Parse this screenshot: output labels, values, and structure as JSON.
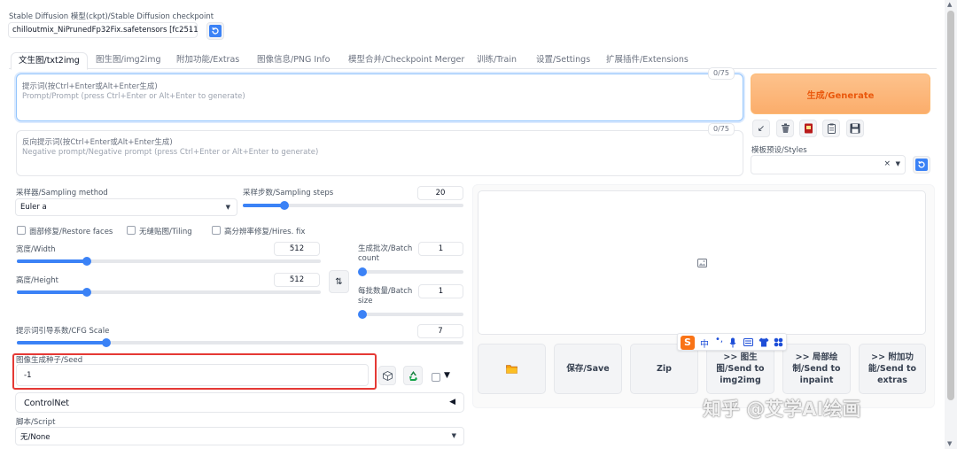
{
  "checkpoint": {
    "label": "Stable Diffusion 模型(ckpt)/Stable Diffusion checkpoint",
    "value": "chilloutmix_NiPrunedFp32Fix.safetensors [fc2511"
  },
  "tabs": [
    {
      "label": "文生图/txt2img"
    },
    {
      "label": "图生图/img2img"
    },
    {
      "label": "附加功能/Extras"
    },
    {
      "label": "图像信息/PNG Info"
    },
    {
      "label": "模型合并/Checkpoint Merger"
    },
    {
      "label": "训练/Train"
    },
    {
      "label": "设置/Settings"
    },
    {
      "label": "扩展插件/Extensions"
    }
  ],
  "prompt": {
    "counter": "0/75",
    "placeholder_line1": "提示词(按Ctrl+Enter或Alt+Enter生成)",
    "placeholder_line2": "Prompt/Prompt (press Ctrl+Enter or Alt+Enter to generate)"
  },
  "negative_prompt": {
    "counter": "0/75",
    "placeholder_line1": "反向提示词(按Ctrl+Enter或Alt+Enter生成)",
    "placeholder_line2": "Negative prompt/Negative prompt (press Ctrl+Enter or Alt+Enter to generate)"
  },
  "generate_label": "生成/Generate",
  "styles_label": "模板预设/Styles",
  "sampler": {
    "label": "采样器/Sampling method",
    "value": "Euler a"
  },
  "steps": {
    "label": "采样步数/Sampling steps",
    "value": "20",
    "fraction": 0.19
  },
  "checkboxes": {
    "restore_faces": "面部修复/Restore faces",
    "tiling": "无缝贴图/Tiling",
    "hires_fix": "高分辨率修复/Hires. fix"
  },
  "width": {
    "label": "宽度/Width",
    "value": "512",
    "fraction": 0.23
  },
  "height": {
    "label": "高度/Height",
    "value": "512",
    "fraction": 0.23
  },
  "batch_count": {
    "label_line1": "生成批次/Batch",
    "label_line2": "count",
    "value": "1",
    "fraction": 0.0
  },
  "batch_size": {
    "label_line1": "每批数量/Batch",
    "label_line2": "size",
    "value": "1",
    "fraction": 0.0
  },
  "cfg": {
    "label": "提示词引导系数/CFG Scale",
    "value": "7",
    "fraction": 0.2
  },
  "seed": {
    "label": "图像生成种子/Seed",
    "value": "-1"
  },
  "controlnet_label": "ControlNet",
  "script": {
    "label": "脚本/Script",
    "value": "无/None"
  },
  "output_buttons": {
    "save": "保存/Save",
    "zip": "Zip",
    "send_img2img_1": ">> 图生",
    "send_img2img_2": "图/Send to",
    "send_img2img_3": "img2img",
    "send_inpaint_1": ">> 局部绘",
    "send_inpaint_2": "制/Send to",
    "send_inpaint_3": "inpaint",
    "send_extras_1": ">> 附加功",
    "send_extras_2": "能/Send to",
    "send_extras_3": "extras"
  },
  "ime_char": "中",
  "watermark": "知乎 @艾学AI绘画",
  "colors": {
    "generate_bg": "#fdba74",
    "accent": "#3b82f6",
    "highlight": "#e53935"
  }
}
